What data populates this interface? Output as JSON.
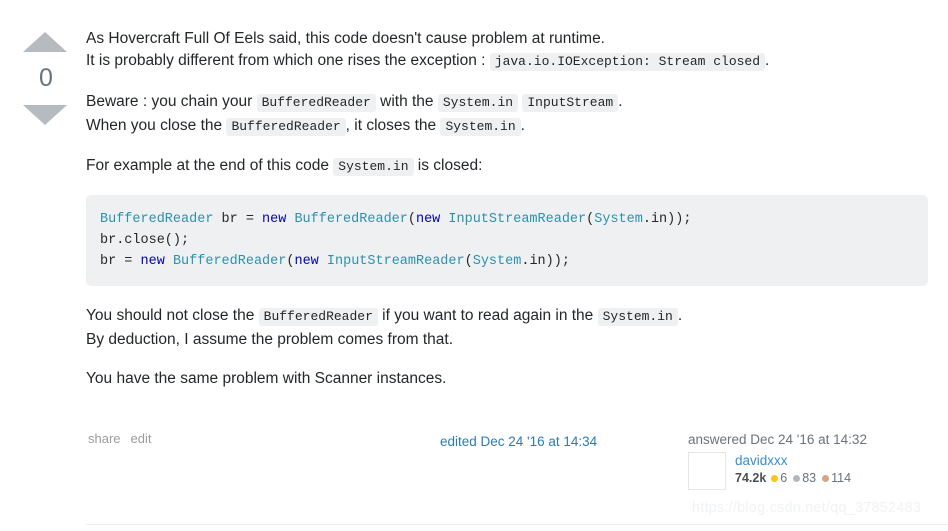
{
  "vote": {
    "up_icon": "triangle-up-icon",
    "down_icon": "triangle-down-icon",
    "count": "0"
  },
  "post": {
    "paragraph1_part1": "As Hovercraft Full Of Eels said, this code doesn't cause problem at runtime.",
    "paragraph1_part2": "It is probably different from which one rises the exception : ",
    "paragraph1_code": "java.io.IOException: Stream closed",
    "paragraph1_end": ".",
    "paragraph2_line1_a": "Beware : you chain your ",
    "paragraph2_code1": "BufferedReader",
    "paragraph2_line1_b": " with the ",
    "paragraph2_code2": "System.in",
    "paragraph2_code3": "InputStream",
    "paragraph2_line1_c": ".",
    "paragraph2_line2_a": "When you close the ",
    "paragraph2_code4": "BufferedReader",
    "paragraph2_line2_b": ", it closes the ",
    "paragraph2_code5": "System.in",
    "paragraph2_line2_c": ".",
    "paragraph3_a": "For example at the end of this code ",
    "paragraph3_code": "System.in",
    "paragraph3_b": " is closed:",
    "paragraph4_a": "You should not close the ",
    "paragraph4_code1": "BufferedReader",
    "paragraph4_b": " if you want to read again in the ",
    "paragraph4_code2": "System.in",
    "paragraph4_c": ".",
    "paragraph4_line2": "By deduction, I assume the problem comes from that.",
    "paragraph5": "You have the same problem with Scanner instances."
  },
  "code_block": {
    "line1": [
      {
        "t": "BufferedReader",
        "c": "cls"
      },
      {
        "t": " br = ",
        "c": "pln"
      },
      {
        "t": "new",
        "c": "kw"
      },
      {
        "t": " ",
        "c": "pln"
      },
      {
        "t": "BufferedReader",
        "c": "cls"
      },
      {
        "t": "(",
        "c": "pln"
      },
      {
        "t": "new",
        "c": "kw"
      },
      {
        "t": " ",
        "c": "pln"
      },
      {
        "t": "InputStreamReader",
        "c": "cls"
      },
      {
        "t": "(",
        "c": "pln"
      },
      {
        "t": "System",
        "c": "cls"
      },
      {
        "t": ".in));",
        "c": "pln"
      }
    ],
    "line2": [
      {
        "t": "br.close();",
        "c": "pln"
      }
    ],
    "line3": [
      {
        "t": "br = ",
        "c": "pln"
      },
      {
        "t": "new",
        "c": "kw"
      },
      {
        "t": " ",
        "c": "pln"
      },
      {
        "t": "BufferedReader",
        "c": "cls"
      },
      {
        "t": "(",
        "c": "pln"
      },
      {
        "t": "new",
        "c": "kw"
      },
      {
        "t": " ",
        "c": "pln"
      },
      {
        "t": "InputStreamReader",
        "c": "cls"
      },
      {
        "t": "(",
        "c": "pln"
      },
      {
        "t": "System",
        "c": "cls"
      },
      {
        "t": ".in));",
        "c": "pln"
      }
    ]
  },
  "footer": {
    "share_label": "share",
    "edit_label": "edit",
    "edited_info": "edited Dec 24 '16 at 14:34",
    "answered_info": "answered Dec 24 '16 at 14:32"
  },
  "user": {
    "name": "davidxxx",
    "reputation": "74.2k",
    "gold_count": "6",
    "silver_count": "83",
    "bronze_count": "114"
  },
  "watermark": {
    "text": "https://blog.csdn.net/qq_37852483"
  },
  "colors": {
    "link": "#2d7bb6",
    "code_bg": "#eff0f1",
    "class_token": "#2b91af",
    "keyword_token": "#0000c0",
    "gold": "#fcc419",
    "silver": "#b4b8bc",
    "bronze": "#d1a684"
  }
}
